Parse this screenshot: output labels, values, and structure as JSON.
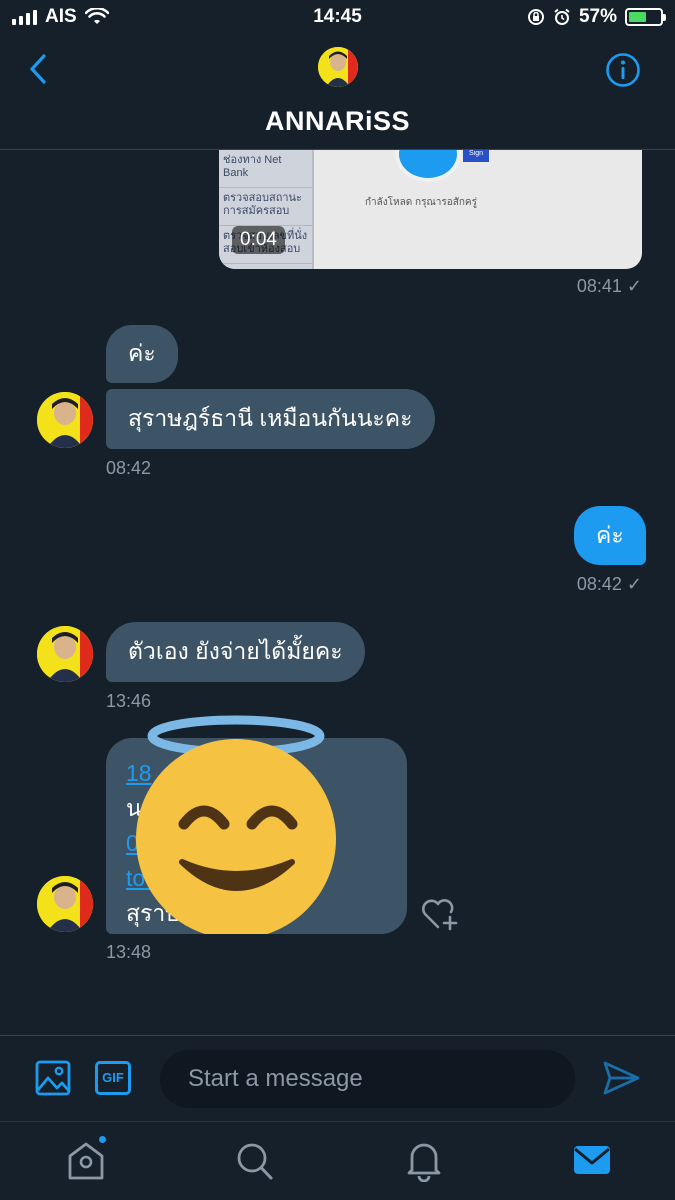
{
  "status_bar": {
    "carrier": "AIS",
    "time": "14:45",
    "battery_percent": "57%",
    "battery_level": 0.57
  },
  "header": {
    "title": "ANNARiSS"
  },
  "video": {
    "duration": "0:04",
    "preview_text": "กำลังโหลด กรุณารอสักครู่",
    "menu_row_1": "ช่องทาง Net Bank",
    "menu_row_2": "ตรวจสอบสถานะการสมัครสอบ",
    "menu_row_3": "ตรวจสอบเลขที่นั่งสอบเข้าห้องสอบ",
    "mini_button": "Sign"
  },
  "messages": [
    {
      "sender": "me",
      "type": "video",
      "time": "08:41",
      "status": "✓"
    },
    {
      "sender": "them",
      "text": "ค่ะ"
    },
    {
      "sender": "them",
      "text": "สุราษฎร์ธานี เหมือนกันนะคะ",
      "time": "08:42"
    },
    {
      "sender": "me",
      "text": "ค่ะ",
      "time": "08:42",
      "status": "✓"
    },
    {
      "sender": "them",
      "text": "ตัวเอง ยังจ่ายได้มั้ยคะ",
      "time": "13:46"
    },
    {
      "sender": "them",
      "type": "card",
      "time": "13:48",
      "lines": [
        {
          "text": "18",
          "link": true
        },
        {
          "text": "น              ทอง",
          "link": false
        },
        {
          "text": "0",
          "link": true
        },
        {
          "text": "to                  l.com",
          "link": true
        },
        {
          "text": "สุราษฎ          ะ",
          "link": false
        }
      ]
    }
  ],
  "composer": {
    "placeholder": "Start a message",
    "gif_label": "GIF"
  },
  "icons": {
    "back": "chevron-left-icon",
    "info": "info-icon",
    "image": "image-icon",
    "send": "send-icon",
    "heart": "heart-plus-icon",
    "home": "home-icon",
    "search": "search-icon",
    "notifications": "bell-icon",
    "messages": "mail-icon",
    "sticker": "smiling-face-with-halo-emoji"
  },
  "colors": {
    "background": "#15202b",
    "accent": "#1d9bf0",
    "bubble_them": "#3d5466",
    "muted_text": "#8b98a5"
  }
}
